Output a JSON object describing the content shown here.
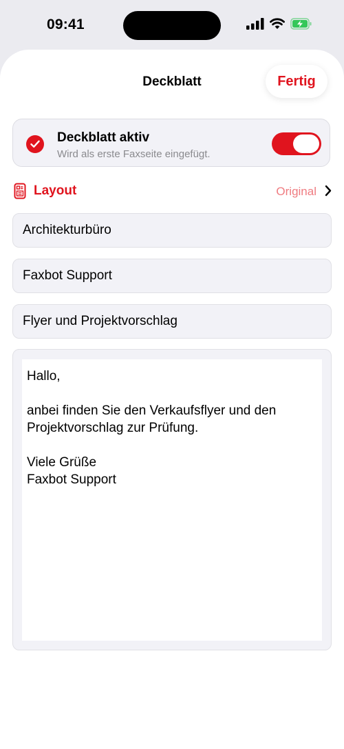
{
  "status_bar": {
    "time": "09:41"
  },
  "sheet": {
    "title": "Deckblatt",
    "done_label": "Fertig"
  },
  "cover_toggle": {
    "title": "Deckblatt aktiv",
    "subtitle": "Wird als erste Faxseite eingefügt.",
    "enabled": true
  },
  "layout": {
    "label": "Layout",
    "value": "Original"
  },
  "fields": {
    "recipient": "Architekturbüro",
    "sender": "Faxbot Support",
    "subject": "Flyer und Projektvorschlag"
  },
  "message": {
    "body": "Hallo,\n\nanbei finden Sie den Verkaufsflyer und den Projektvorschlag zur Prüfung.\n\nViele Grüße\nFaxbot Support"
  },
  "colors": {
    "accent": "#e0141e",
    "accent_light": "#ef7b80",
    "field_background": "#f2f2f7",
    "battery": "#34c759"
  },
  "icons": {
    "signal": "cellular-signal-icon",
    "wifi": "wifi-icon",
    "battery": "battery-charging-icon",
    "check": "checkmark-circle-icon",
    "layout": "document-layout-icon",
    "chevron": "chevron-right-icon"
  }
}
